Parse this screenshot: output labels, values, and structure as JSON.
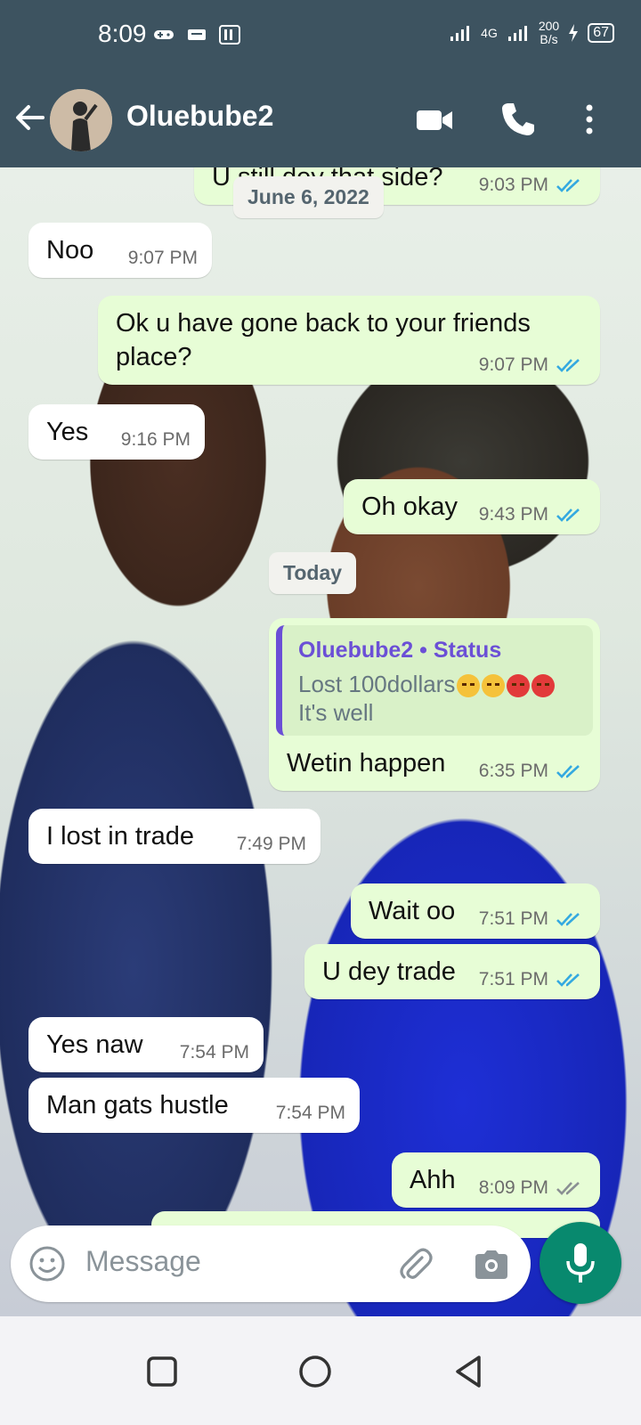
{
  "status_bar": {
    "time": "8:09",
    "network": "4G",
    "speed_value": "200",
    "speed_unit": "B/s",
    "battery": "67"
  },
  "header": {
    "contact_name": "Oluebube2",
    "icons": [
      "back-arrow-icon",
      "video-call-icon",
      "phone-icon",
      "more-vert-icon"
    ]
  },
  "messages": [
    {
      "dir": "out",
      "text": "U still dey that side?",
      "time": "9:03 PM",
      "status": "read"
    },
    {
      "dir": "in",
      "text": "Noo",
      "time": "9:07 PM"
    },
    {
      "dir": "out",
      "text": "Ok u have gone back to your friends place?",
      "time": "9:07 PM",
      "status": "read"
    },
    {
      "dir": "in",
      "text": "Yes",
      "time": "9:16 PM"
    },
    {
      "dir": "out",
      "text": "Oh okay",
      "time": "9:43 PM",
      "status": "read"
    },
    {
      "dir": "out",
      "quote_name": "Oluebube2 • Status",
      "quote_text_1": "Lost 100dollars",
      "quote_text_2": "It's well",
      "text": "Wetin happen",
      "time": "6:35 PM",
      "status": "read"
    },
    {
      "dir": "in",
      "text": "I lost in trade",
      "time": "7:49 PM"
    },
    {
      "dir": "out",
      "text": "Wait oo",
      "time": "7:51 PM",
      "status": "read"
    },
    {
      "dir": "out",
      "text": "U dey trade",
      "time": "7:51 PM",
      "status": "read"
    },
    {
      "dir": "in",
      "text": "Yes naw",
      "time": "7:54 PM"
    },
    {
      "dir": "in",
      "text": "Man gats hustle",
      "time": "7:54 PM"
    },
    {
      "dir": "out",
      "text": "Ahh",
      "time": "8:09 PM",
      "status": "delivered"
    }
  ],
  "date_chips": {
    "first": "June 6, 2022",
    "second": "Today"
  },
  "input": {
    "placeholder": "Message"
  },
  "colors": {
    "header_bg": "#3d5360",
    "outgoing_bubble": "#e7fdd6",
    "incoming_bubble": "#ffffff",
    "read_tick": "#34a9e0",
    "mic_button": "#08896e",
    "quote_accent": "#6b4fd6"
  }
}
